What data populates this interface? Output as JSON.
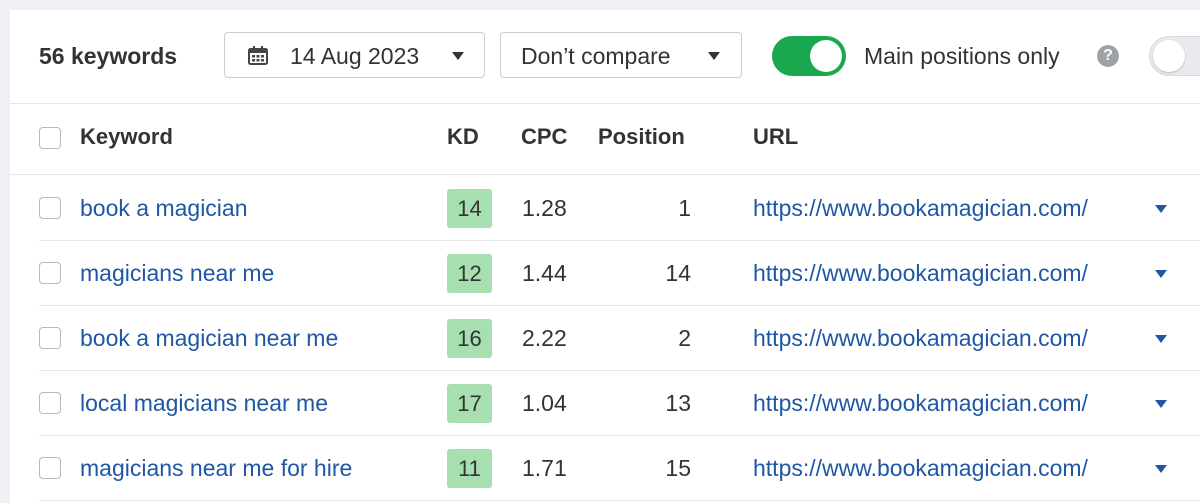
{
  "toolbar": {
    "keyword_count": "56 keywords",
    "date_label": "14 Aug 2023",
    "compare_label": "Don’t compare",
    "main_positions_label": "Main positions only",
    "help_glyph": "?",
    "main_positions_toggle": true,
    "second_toggle": false
  },
  "table": {
    "headers": {
      "keyword": "Keyword",
      "kd": "KD",
      "cpc": "CPC",
      "position": "Position",
      "url": "URL"
    },
    "rows": [
      {
        "keyword": "book a magician",
        "kd": "14",
        "cpc": "1.28",
        "position": "1",
        "url": "https://www.bookamagician.com/"
      },
      {
        "keyword": "magicians near me",
        "kd": "12",
        "cpc": "1.44",
        "position": "14",
        "url": "https://www.bookamagician.com/"
      },
      {
        "keyword": "book a magician near me",
        "kd": "16",
        "cpc": "2.22",
        "position": "2",
        "url": "https://www.bookamagician.com/"
      },
      {
        "keyword": "local magicians near me",
        "kd": "17",
        "cpc": "1.04",
        "position": "13",
        "url": "https://www.bookamagician.com/"
      },
      {
        "keyword": "magicians near me for hire",
        "kd": "11",
        "cpc": "1.71",
        "position": "15",
        "url": "https://www.bookamagician.com/"
      }
    ]
  },
  "colors": {
    "link": "#1f57a4",
    "toggle_on": "#1aa84f",
    "kd_easy": "#a8dfb0"
  },
  "icons": {
    "date": "calendar-icon",
    "dropdown": "caret-down-icon",
    "help": "help-icon"
  }
}
